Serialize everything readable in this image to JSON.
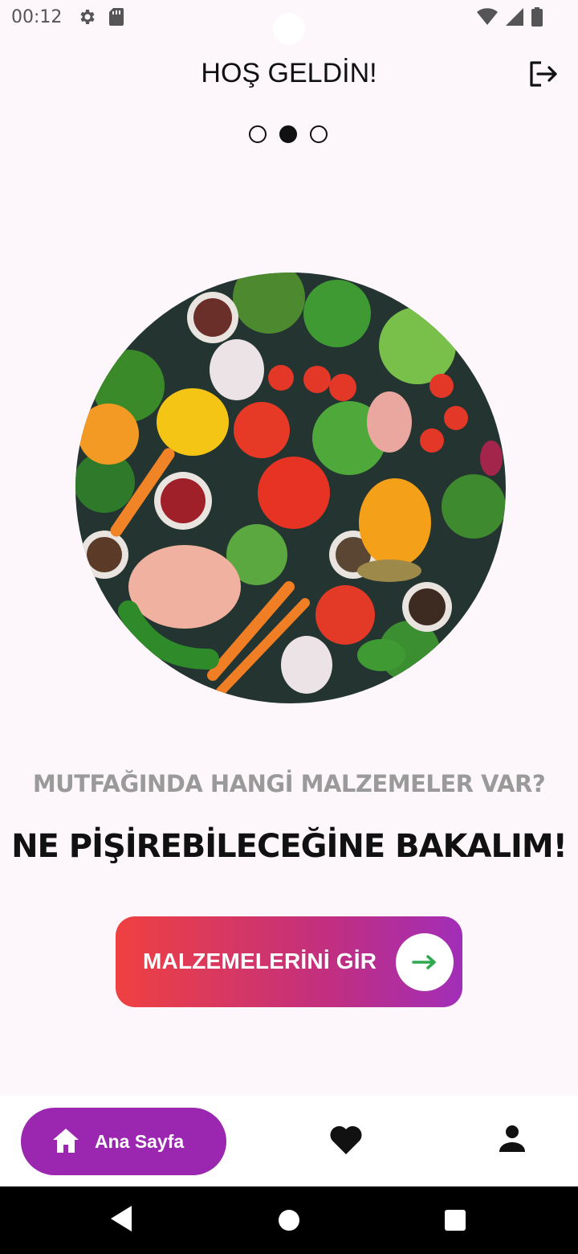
{
  "status_bar": {
    "time": "00:12",
    "left_icons": [
      "gear-icon",
      "sd-card-icon"
    ],
    "right_icons": [
      "wifi-icon",
      "signal-icon",
      "battery-icon"
    ]
  },
  "header": {
    "title": "HOŞ GELDİN!",
    "logout_icon": "logout-icon"
  },
  "pager": {
    "count": 3,
    "active_index": 1
  },
  "hero": {
    "icon": "vegetable-platter-illustration"
  },
  "content": {
    "subtitle": "MUTFAĞINDA HANGİ MALZEMELER VAR?",
    "headline": "NE PİŞİREBİLECEĞİNE BAKALIM!"
  },
  "cta": {
    "label": "MALZEMELERİNİ GİR",
    "icon": "arrow-right-icon",
    "gradient": [
      "#ef4141",
      "#c22f7e",
      "#a12eb8"
    ],
    "arrow_color": "#2fa84f"
  },
  "bottom_nav": {
    "home_label": "Ana Sayfa",
    "home_icon": "home-icon",
    "favorites_icon": "heart-icon",
    "profile_icon": "person-icon",
    "active_color": "#9b27b0"
  },
  "system_nav": {
    "icons": [
      "back-icon",
      "home-circle-icon",
      "recents-icon"
    ]
  }
}
